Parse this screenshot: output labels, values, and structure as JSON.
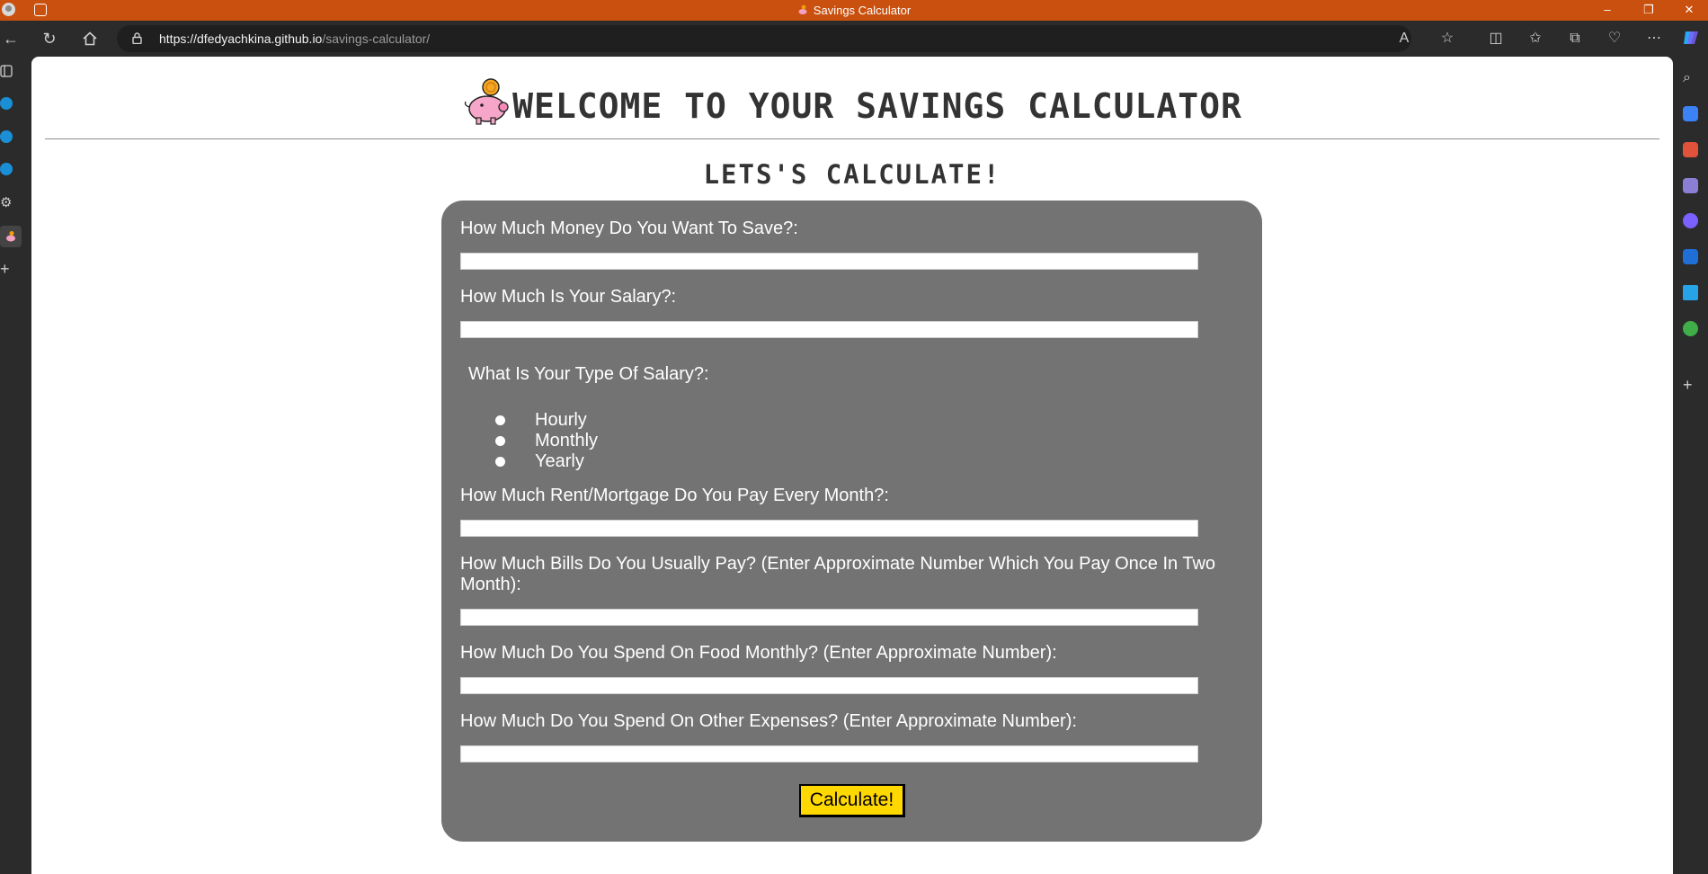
{
  "browser": {
    "window_title": "Savings Calculator",
    "url_host": "https://dfedyachkina.github.io",
    "url_path": "/savings-calculator/",
    "window_controls": [
      "–",
      "❐",
      "✕"
    ]
  },
  "page": {
    "heading": "WELCOME TO YOUR SAVINGS CALCULATOR",
    "subheading": "LETS'S CALCULATE!",
    "form": {
      "savings_goal_label": "How Much Money Do You Want To Save?:",
      "salary_label": "How Much Is Your Salary?:",
      "salary_type_label": "What Is Your Type Of Salary?:",
      "salary_types": [
        "Hourly",
        "Monthly",
        "Yearly"
      ],
      "rent_label": "How Much Rent/Mortgage Do You Pay Every Month?:",
      "bills_label_line1": "How Much Bills Do You Usually Pay? (Enter Approximate Number Which You Pay Once In Two",
      "bills_label_line2": "Month):",
      "food_label": "How Much Do You Spend On Food Monthly? (Enter Approximate Number):",
      "other_label": "How Much Do You Spend On Other Expenses? (Enter Approximate Number):",
      "submit_label": "Calculate!"
    }
  },
  "colors": {
    "titlebar": "#c9500f",
    "card": "#737373",
    "button": "#ffd800",
    "heading_text": "#333333"
  }
}
